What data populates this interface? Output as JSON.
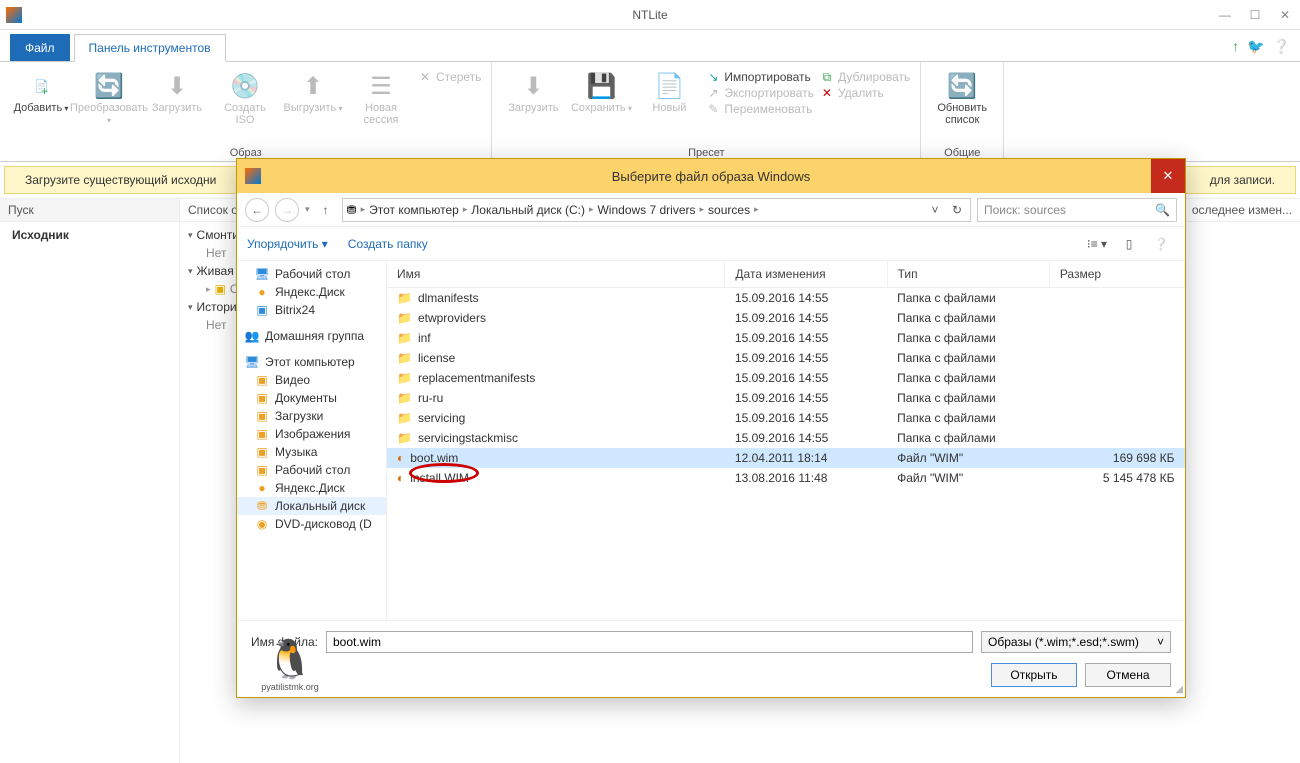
{
  "app": {
    "title": "NTLite"
  },
  "menu": {
    "file": "Файл",
    "toolbar": "Панель инструментов",
    "help_icons": {
      "upgrade": "↑",
      "twitter": "t",
      "help": "?"
    }
  },
  "ribbon": {
    "group_image": {
      "label": "Образ",
      "add": "Добавить",
      "transform": "Преобразовать",
      "load": "Загрузить",
      "create_iso": "Создать ISO",
      "unload": "Выгрузить",
      "new_session": "Новая сессия",
      "erase": "Стереть"
    },
    "group_preset": {
      "label": "Пресет",
      "load": "Загрузить",
      "save": "Сохранить",
      "new": "Новый",
      "import": "Импортировать",
      "export": "Экспортировать",
      "rename": "Переименовать",
      "duplicate": "Дублировать",
      "delete": "Удалить"
    },
    "group_common": {
      "label": "Общие",
      "refresh": "Обновить список"
    }
  },
  "infobar": "Загрузите существующий исходни",
  "infobar_tail": "для записи.",
  "left": {
    "start": "Пуск",
    "source": "Исходник"
  },
  "right_header": {
    "history": "Список о...",
    "last": "оследнее измен..."
  },
  "rtree": {
    "mounted": "Смонтир",
    "mounted_sub": "Нет",
    "orig": "О",
    "live": "Живая у",
    "history": "История",
    "history_sub": "Нет"
  },
  "dialog": {
    "title": "Выберите файл образа Windows",
    "breadcrumb": [
      "Этот компьютер",
      "Локальный диск (C:)",
      "Windows 7 drivers",
      "sources"
    ],
    "search_placeholder": "Поиск: sources",
    "organize": "Упорядочить",
    "newfolder": "Создать папку",
    "columns": {
      "name": "Имя",
      "date": "Дата изменения",
      "type": "Тип",
      "size": "Размер"
    },
    "tree_top": [
      {
        "label": "Рабочий стол",
        "icon": "🖥",
        "color": "c-blue"
      },
      {
        "label": "Яндекс.Диск",
        "icon": "●",
        "color": "c-orange"
      },
      {
        "label": "Bitrix24",
        "icon": "▣",
        "color": "c-blue"
      }
    ],
    "tree_homegroup": "Домашняя группа",
    "tree_pc": "Этот компьютер",
    "tree_pc_items": [
      {
        "label": "Видео",
        "icon": "▣"
      },
      {
        "label": "Документы",
        "icon": "▣"
      },
      {
        "label": "Загрузки",
        "icon": "▣"
      },
      {
        "label": "Изображения",
        "icon": "▣"
      },
      {
        "label": "Музыка",
        "icon": "▣"
      },
      {
        "label": "Рабочий стол",
        "icon": "▣"
      },
      {
        "label": "Яндекс.Диск",
        "icon": "●"
      },
      {
        "label": "Локальный диск",
        "icon": "⛃",
        "sel": true
      },
      {
        "label": "DVD-дисковод (D",
        "icon": "◉"
      }
    ],
    "files": [
      {
        "name": "dlmanifests",
        "date": "15.09.2016 14:55",
        "type": "Папка с файлами",
        "size": "",
        "kind": "folder"
      },
      {
        "name": "etwproviders",
        "date": "15.09.2016 14:55",
        "type": "Папка с файлами",
        "size": "",
        "kind": "folder"
      },
      {
        "name": "inf",
        "date": "15.09.2016 14:55",
        "type": "Папка с файлами",
        "size": "",
        "kind": "folder"
      },
      {
        "name": "license",
        "date": "15.09.2016 14:55",
        "type": "Папка с файлами",
        "size": "",
        "kind": "folder"
      },
      {
        "name": "replacementmanifests",
        "date": "15.09.2016 14:55",
        "type": "Папка с файлами",
        "size": "",
        "kind": "folder"
      },
      {
        "name": "ru-ru",
        "date": "15.09.2016 14:55",
        "type": "Папка с файлами",
        "size": "",
        "kind": "folder"
      },
      {
        "name": "servicing",
        "date": "15.09.2016 14:55",
        "type": "Папка с файлами",
        "size": "",
        "kind": "folder"
      },
      {
        "name": "servicingstackmisc",
        "date": "15.09.2016 14:55",
        "type": "Папка с файлами",
        "size": "",
        "kind": "folder"
      },
      {
        "name": "boot.wim",
        "date": "12.04.2011 18:14",
        "type": "Файл \"WIM\"",
        "size": "169 698 КБ",
        "kind": "wim",
        "selected": true
      },
      {
        "name": "install.WIM",
        "date": "13.08.2016 11:48",
        "type": "Файл \"WIM\"",
        "size": "5 145 478 КБ",
        "kind": "wim"
      }
    ],
    "filename_label": "Имя файла:",
    "filename_value": "boot.wim",
    "filter": "Образы (*.wim;*.esd;*.swm)",
    "open": "Открыть",
    "cancel": "Отмена"
  },
  "watermark": "pyatilistmk.org"
}
